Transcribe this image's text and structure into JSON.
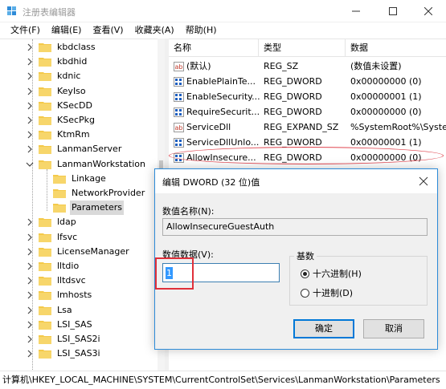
{
  "window": {
    "title": "注册表编辑器",
    "minimize_icon": "minimize-icon",
    "maximize_icon": "maximize-icon",
    "close_icon": "close-icon"
  },
  "menu": [
    "文件(F)",
    "编辑(E)",
    "查看(V)",
    "收藏夹(A)",
    "帮助(H)"
  ],
  "tree": {
    "items": [
      {
        "label": "kbdclass",
        "level": 1
      },
      {
        "label": "kbdhid",
        "level": 1
      },
      {
        "label": "kdnic",
        "level": 1
      },
      {
        "label": "KeyIso",
        "level": 1
      },
      {
        "label": "KSecDD",
        "level": 1
      },
      {
        "label": "KSecPkg",
        "level": 1
      },
      {
        "label": "KtmRm",
        "level": 1
      },
      {
        "label": "LanmanServer",
        "level": 1
      },
      {
        "label": "LanmanWorkstation",
        "level": 1,
        "expanded": true
      },
      {
        "label": "Linkage",
        "level": 2
      },
      {
        "label": "NetworkProvider",
        "level": 2
      },
      {
        "label": "Parameters",
        "level": 2,
        "selected": true
      },
      {
        "label": "ldap",
        "level": 1
      },
      {
        "label": "lfsvc",
        "level": 1
      },
      {
        "label": "LicenseManager",
        "level": 1
      },
      {
        "label": "lltdio",
        "level": 1
      },
      {
        "label": "lltdsvc",
        "level": 1
      },
      {
        "label": "lmhosts",
        "level": 1
      },
      {
        "label": "Lsa",
        "level": 1
      },
      {
        "label": "LSI_SAS",
        "level": 1
      },
      {
        "label": "LSI_SAS2i",
        "level": 1
      },
      {
        "label": "LSI_SAS3i",
        "level": 1
      }
    ]
  },
  "list": {
    "columns": [
      "名称",
      "类型",
      "数据"
    ],
    "rows": [
      {
        "icon": "string-value-icon",
        "name": "(默认)",
        "type": "REG_SZ",
        "data": "(数值未设置)"
      },
      {
        "icon": "binary-value-icon",
        "name": "EnablePlainTe...",
        "type": "REG_DWORD",
        "data": "0x00000000 (0)"
      },
      {
        "icon": "binary-value-icon",
        "name": "EnableSecurity...",
        "type": "REG_DWORD",
        "data": "0x00000001 (1)"
      },
      {
        "icon": "binary-value-icon",
        "name": "RequireSecurit...",
        "type": "REG_DWORD",
        "data": "0x00000000 (0)"
      },
      {
        "icon": "string-value-icon",
        "name": "ServiceDll",
        "type": "REG_EXPAND_SZ",
        "data": "%SystemRoot%\\Syster"
      },
      {
        "icon": "binary-value-icon",
        "name": "ServiceDllUnlo...",
        "type": "REG_DWORD",
        "data": "0x00000001 (1)"
      },
      {
        "icon": "binary-value-icon",
        "name": "AllowInsecure...",
        "type": "REG_DWORD",
        "data": "0x00000000 (0)",
        "highlighted": true
      }
    ]
  },
  "status": {
    "path": "计算机\\HKEY_LOCAL_MACHINE\\SYSTEM\\CurrentControlSet\\Services\\LanmanWorkstation\\Parameters"
  },
  "dialog": {
    "title": "编辑 DWORD (32 位)值",
    "name_label": "数值名称(N):",
    "name_value": "AllowInsecureGuestAuth",
    "data_label": "数值数据(V):",
    "data_value": "1",
    "base_label": "基数",
    "radio_hex": "十六进制(H)",
    "radio_dec": "十进制(D)",
    "selected_base": "hex",
    "ok_label": "确定",
    "cancel_label": "取消"
  },
  "colors": {
    "folder": "#f4c94a",
    "accent": "#0078d7",
    "annotation_red": "#e0303a"
  }
}
